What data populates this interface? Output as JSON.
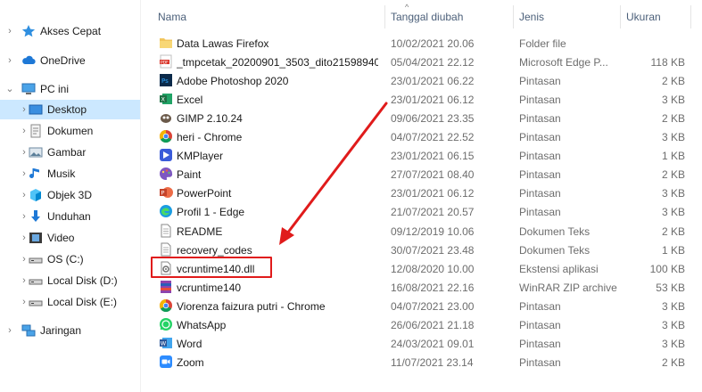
{
  "nav": {
    "items": [
      {
        "label": "Akses Cepat",
        "icon": "star-icon",
        "depth": 0,
        "chevron": "›",
        "selected": false
      },
      {
        "label": "OneDrive",
        "icon": "cloud-icon",
        "depth": 0,
        "chevron": "›",
        "selected": false
      },
      {
        "label": "PC ini",
        "icon": "computer-icon",
        "depth": 0,
        "chevron": "⌄",
        "selected": false
      },
      {
        "label": "Desktop",
        "icon": "desktop-icon",
        "depth": 1,
        "chevron": "›",
        "selected": true
      },
      {
        "label": "Dokumen",
        "icon": "documents-icon",
        "depth": 1,
        "chevron": "›",
        "selected": false
      },
      {
        "label": "Gambar",
        "icon": "pictures-icon",
        "depth": 1,
        "chevron": "›",
        "selected": false
      },
      {
        "label": "Musik",
        "icon": "music-icon",
        "depth": 1,
        "chevron": "›",
        "selected": false
      },
      {
        "label": "Objek 3D",
        "icon": "cube-icon",
        "depth": 1,
        "chevron": "›",
        "selected": false
      },
      {
        "label": "Unduhan",
        "icon": "download-icon",
        "depth": 1,
        "chevron": "›",
        "selected": false
      },
      {
        "label": "Video",
        "icon": "video-icon",
        "depth": 1,
        "chevron": "›",
        "selected": false
      },
      {
        "label": "OS (C:)",
        "icon": "drive-icon",
        "depth": 1,
        "chevron": "›",
        "selected": false
      },
      {
        "label": "Local Disk (D:)",
        "icon": "drive-icon",
        "depth": 1,
        "chevron": "›",
        "selected": false
      },
      {
        "label": "Local Disk (E:)",
        "icon": "drive-icon",
        "depth": 1,
        "chevron": "›",
        "selected": false
      },
      {
        "label": "Jaringan",
        "icon": "network-icon",
        "depth": 0,
        "chevron": "›",
        "selected": false
      }
    ]
  },
  "columns": {
    "name": "Nama",
    "date": "Tanggal diubah",
    "type": "Jenis",
    "size": "Ukuran",
    "sort_indicator": "^"
  },
  "files": [
    {
      "name": "Data Lawas Firefox",
      "date": "10/02/2021 20.06",
      "type": "Folder file",
      "size": "",
      "icon": "folder-icon",
      "color": "#f2c55c"
    },
    {
      "name": "_tmpcetak_20200901_3503_dito215989407...",
      "date": "05/04/2021 22.12",
      "type": "Microsoft Edge P...",
      "size": "118 KB",
      "icon": "pdf-icon",
      "color": "#d9352a"
    },
    {
      "name": "Adobe Photoshop 2020",
      "date": "23/01/2021 06.22",
      "type": "Pintasan",
      "size": "2 KB",
      "icon": "photoshop-icon",
      "color": "#0b2a4a"
    },
    {
      "name": "Excel",
      "date": "23/01/2021 06.12",
      "type": "Pintasan",
      "size": "3 KB",
      "icon": "excel-icon",
      "color": "#1d7044"
    },
    {
      "name": "GIMP 2.10.24",
      "date": "09/06/2021 23.35",
      "type": "Pintasan",
      "size": "2 KB",
      "icon": "gimp-icon",
      "color": "#6b5a4a"
    },
    {
      "name": "heri - Chrome",
      "date": "04/07/2021 22.52",
      "type": "Pintasan",
      "size": "3 KB",
      "icon": "chrome-icon",
      "color": "#4285f4"
    },
    {
      "name": "KMPlayer",
      "date": "23/01/2021 06.15",
      "type": "Pintasan",
      "size": "1 KB",
      "icon": "kmplayer-icon",
      "color": "#3a5bd9"
    },
    {
      "name": "Paint",
      "date": "27/07/2021 08.40",
      "type": "Pintasan",
      "size": "2 KB",
      "icon": "paint-icon",
      "color": "#7e57c2"
    },
    {
      "name": "PowerPoint",
      "date": "23/01/2021 06.12",
      "type": "Pintasan",
      "size": "3 KB",
      "icon": "powerpoint-icon",
      "color": "#c4432a"
    },
    {
      "name": "Profil 1 - Edge",
      "date": "21/07/2021 20.57",
      "type": "Pintasan",
      "size": "3 KB",
      "icon": "edge-icon",
      "color": "#1b9de2"
    },
    {
      "name": "README",
      "date": "09/12/2019 10.06",
      "type": "Dokumen Teks",
      "size": "2 KB",
      "icon": "text-file-icon",
      "color": "#8a8a8a"
    },
    {
      "name": "recovery_codes",
      "date": "30/07/2021 23.48",
      "type": "Dokumen Teks",
      "size": "1 KB",
      "icon": "text-file-icon",
      "color": "#8a8a8a"
    },
    {
      "name": "vcruntime140.dll",
      "date": "12/08/2020 10.00",
      "type": "Ekstensi aplikasi",
      "size": "100 KB",
      "icon": "dll-gear-icon",
      "color": "#8a8a8a"
    },
    {
      "name": "vcruntime140",
      "date": "16/08/2021 22.16",
      "type": "WinRAR ZIP archive",
      "size": "53 KB",
      "icon": "winrar-icon",
      "color": "#2b5db8"
    },
    {
      "name": "Viorenza faizura putri - Chrome",
      "date": "04/07/2021 23.00",
      "type": "Pintasan",
      "size": "3 KB",
      "icon": "chrome-icon",
      "color": "#4285f4"
    },
    {
      "name": "WhatsApp",
      "date": "26/06/2021 21.18",
      "type": "Pintasan",
      "size": "3 KB",
      "icon": "whatsapp-icon",
      "color": "#25d366"
    },
    {
      "name": "Word",
      "date": "24/03/2021 09.01",
      "type": "Pintasan",
      "size": "3 KB",
      "icon": "word-icon",
      "color": "#2b579a"
    },
    {
      "name": "Zoom",
      "date": "11/07/2021 23.14",
      "type": "Pintasan",
      "size": "2 KB",
      "icon": "zoom-icon",
      "color": "#2d8cff"
    }
  ],
  "annotation": {
    "color": "#e01b1b"
  }
}
